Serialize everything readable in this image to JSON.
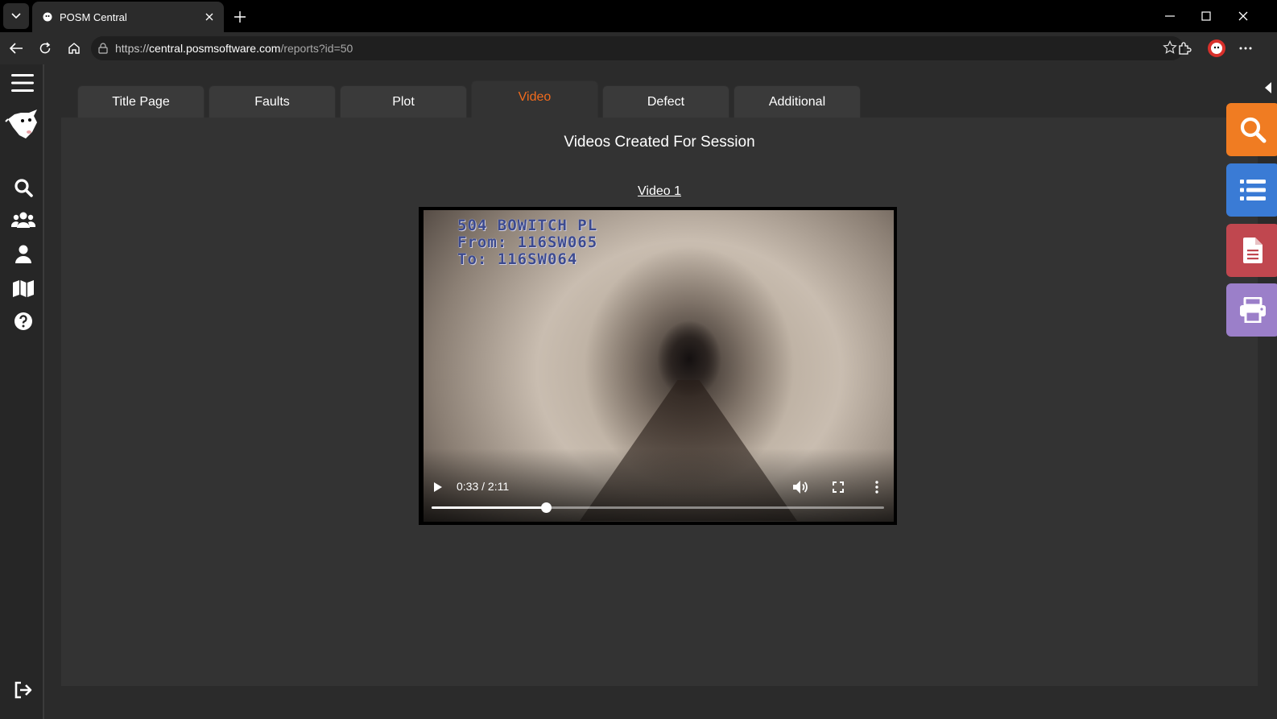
{
  "browser": {
    "tab_title": "POSM Central",
    "url_scheme": "https://",
    "url_host": "central.posmsoftware.com",
    "url_path": "/reports?id=50"
  },
  "report_tabs": [
    {
      "label": "Title Page",
      "active": false
    },
    {
      "label": "Faults",
      "active": false
    },
    {
      "label": "Plot",
      "active": false
    },
    {
      "label": "Video",
      "active": true
    },
    {
      "label": "Defect",
      "active": false
    },
    {
      "label": "Additional",
      "active": false
    }
  ],
  "main": {
    "section_title": "Videos Created For Session",
    "video_link": "Video 1"
  },
  "video": {
    "osd_line1": "504 BOWITCH PL",
    "osd_line2": "From: 116SW065",
    "osd_line3": "To: 116SW064",
    "time": "0:33 / 2:11",
    "progress": 0.252
  },
  "left_nav": [
    "menu-icon",
    "posm-logo",
    "search-icon",
    "users-icon",
    "user-icon",
    "map-icon",
    "help-icon",
    "logout-icon"
  ],
  "tools": [
    {
      "name": "search-tool",
      "color": "#f07c22"
    },
    {
      "name": "list-tool",
      "color": "#3a7bd5"
    },
    {
      "name": "document-tool",
      "color": "#c0474f"
    },
    {
      "name": "print-tool",
      "color": "#9b7fc9"
    }
  ],
  "colors": {
    "accent_active_tab": "#f26b1d"
  }
}
